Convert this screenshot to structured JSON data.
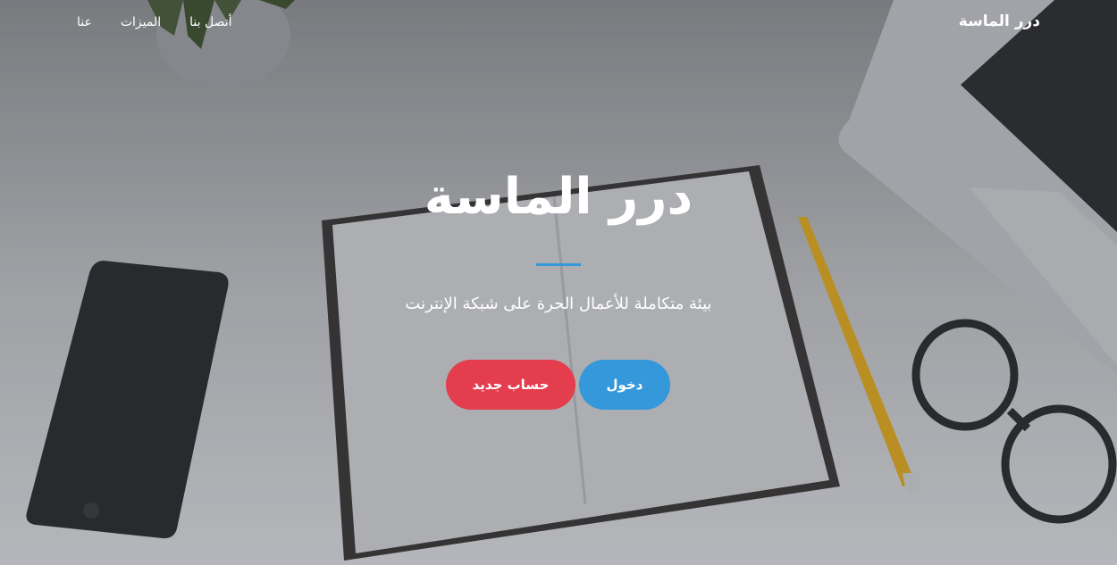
{
  "navbar": {
    "brand": "درر الماسة",
    "links": [
      {
        "label": "عنا"
      },
      {
        "label": "الميزات"
      },
      {
        "label": "أتصل بنا"
      }
    ]
  },
  "hero": {
    "title": "درر الماسة",
    "subtitle": "بيئة متكاملة للأعمال الحرة على شبكة الإنترنت",
    "login_label": "دخول",
    "register_label": "حساب جديد"
  },
  "colors": {
    "accent_blue": "#3498db",
    "accent_red": "#e43d4e"
  }
}
